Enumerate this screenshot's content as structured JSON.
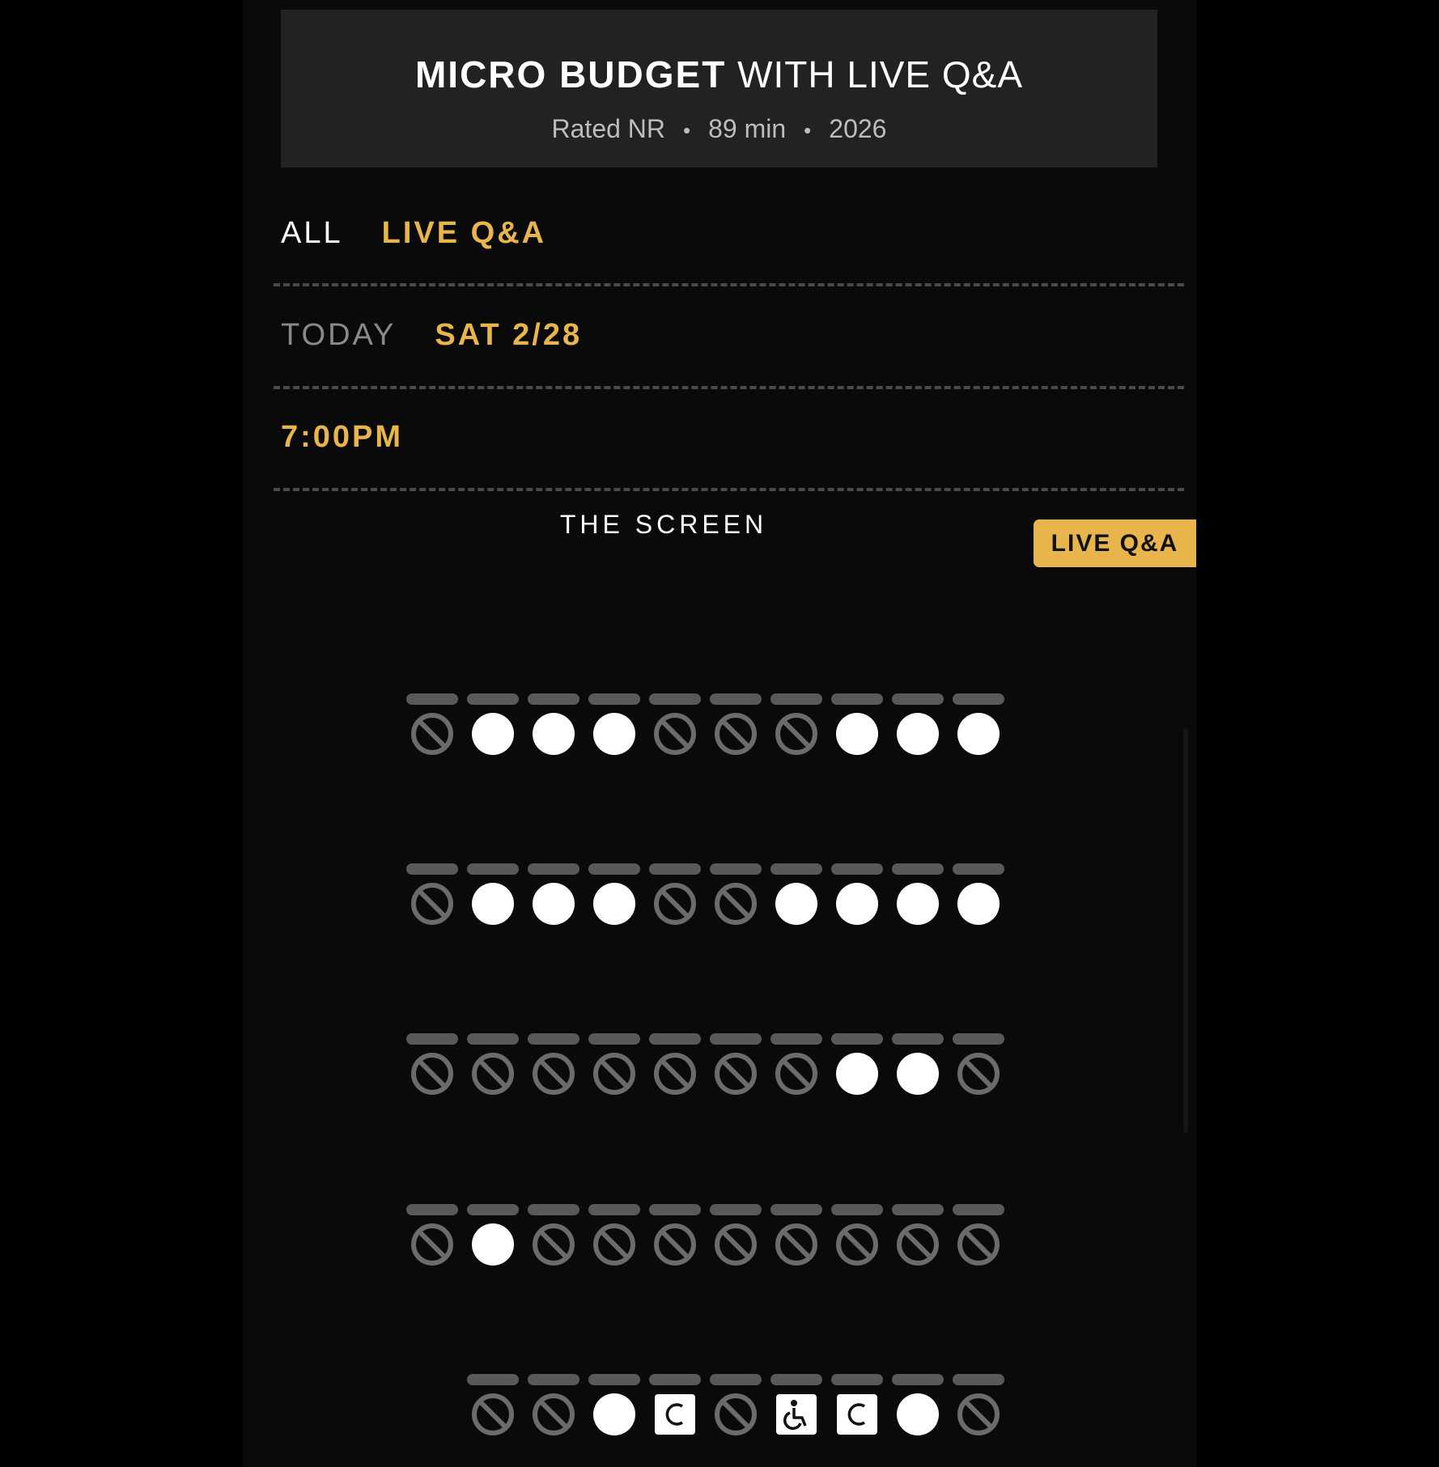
{
  "film": {
    "title_bold": "MICRO BUDGET",
    "title_rest": "WITH LIVE Q&A",
    "rating": "Rated NR",
    "runtime": "89 min",
    "year": "2026"
  },
  "filters": {
    "format": {
      "all_label": "ALL",
      "selected_label": "LIVE Q&A"
    },
    "date": {
      "today_label": "TODAY",
      "selected_label": "SAT 2/28"
    },
    "time": {
      "selected_label": "7:00PM"
    }
  },
  "screen_label": "THE SCREEN",
  "badge_label": "LIVE Q&A",
  "colors": {
    "accent": "#e8b54d",
    "available": "#ffffff",
    "unavailable": "#6b6b6b"
  },
  "seat_map": {
    "legend": {
      "A": "available",
      "X": "unavailable",
      "C": "companion-seat",
      "W": "wheelchair-seat"
    },
    "rows": [
      {
        "seats": [
          "X",
          "A",
          "A",
          "A",
          "X",
          "X",
          "X",
          "A",
          "A",
          "A"
        ]
      },
      {
        "seats": [
          "X",
          "A",
          "A",
          "A",
          "X",
          "X",
          "A",
          "A",
          "A",
          "A"
        ]
      },
      {
        "seats": [
          "X",
          "X",
          "X",
          "X",
          "X",
          "X",
          "X",
          "A",
          "A",
          "X"
        ]
      },
      {
        "seats": [
          "X",
          "A",
          "X",
          "X",
          "X",
          "X",
          "X",
          "X",
          "X",
          "X"
        ]
      },
      {
        "offset": 1,
        "seats": [
          "X",
          "X",
          "A",
          "C",
          "X",
          "W",
          "C",
          "A",
          "X"
        ]
      }
    ]
  }
}
